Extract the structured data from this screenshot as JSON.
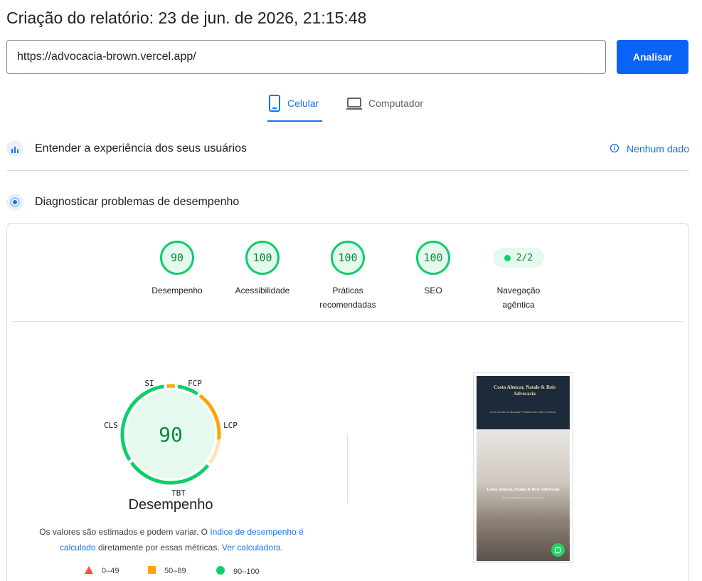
{
  "header": {
    "title": "Criação do relatório: 23 de jun. de 2026, 21:15:48"
  },
  "search": {
    "url": "https://advocacia-brown.vercel.app/",
    "analyze_label": "Analisar"
  },
  "device_tabs": [
    {
      "label": "Celular",
      "icon": "smartphone-icon",
      "active": true
    },
    {
      "label": "Computador",
      "icon": "laptop-icon",
      "active": false
    }
  ],
  "sections": {
    "field_data": {
      "title": "Entender a experiência dos seus usuários",
      "status": "Nenhum dado"
    },
    "diagnostics": {
      "title": "Diagnosticar problemas de desempenho"
    }
  },
  "scores": [
    {
      "label": "Desempenho",
      "value": "90"
    },
    {
      "label": "Acessibilidade",
      "value": "100"
    },
    {
      "label": "Práticas recomendadas",
      "value": "100"
    },
    {
      "label": "SEO",
      "value": "100"
    },
    {
      "label": "Navegação agêntica",
      "value": "2/2"
    }
  ],
  "performance": {
    "score": "90",
    "title": "Desempenho",
    "metrics": [
      "SI",
      "FCP",
      "LCP",
      "TBT",
      "CLS"
    ],
    "note_part1": "Os valores são estimados e podem variar. O ",
    "note_link1": "índice de desempenho é calculado",
    "note_part2": " diretamente por essas métricas. ",
    "note_link2": "Ver calculadora",
    "note_end": "."
  },
  "legend": [
    {
      "range": "0–49",
      "color": "#ff4e42",
      "shape": "triangle"
    },
    {
      "range": "50–89",
      "color": "#ffa400",
      "shape": "square"
    },
    {
      "range": "90–100",
      "color": "#0cce6b",
      "shape": "circle"
    }
  ],
  "screenshot": {
    "brand_line1": "Costa Alencar, Natale & Reis",
    "brand_line2": "Advocacia",
    "nav": "Início  Áreas de atuação  Profissionais  Sobre  Contato",
    "hero_title": "Costa Alencar, Natale & Reis Advocacia",
    "hero_sub": "Atuação estratégica e atendimento próximo."
  },
  "colors": {
    "accent": "#1a73e8",
    "button": "#0b63f6",
    "good": "#0cce6b",
    "average": "#ffa400",
    "poor": "#ff4e42"
  }
}
